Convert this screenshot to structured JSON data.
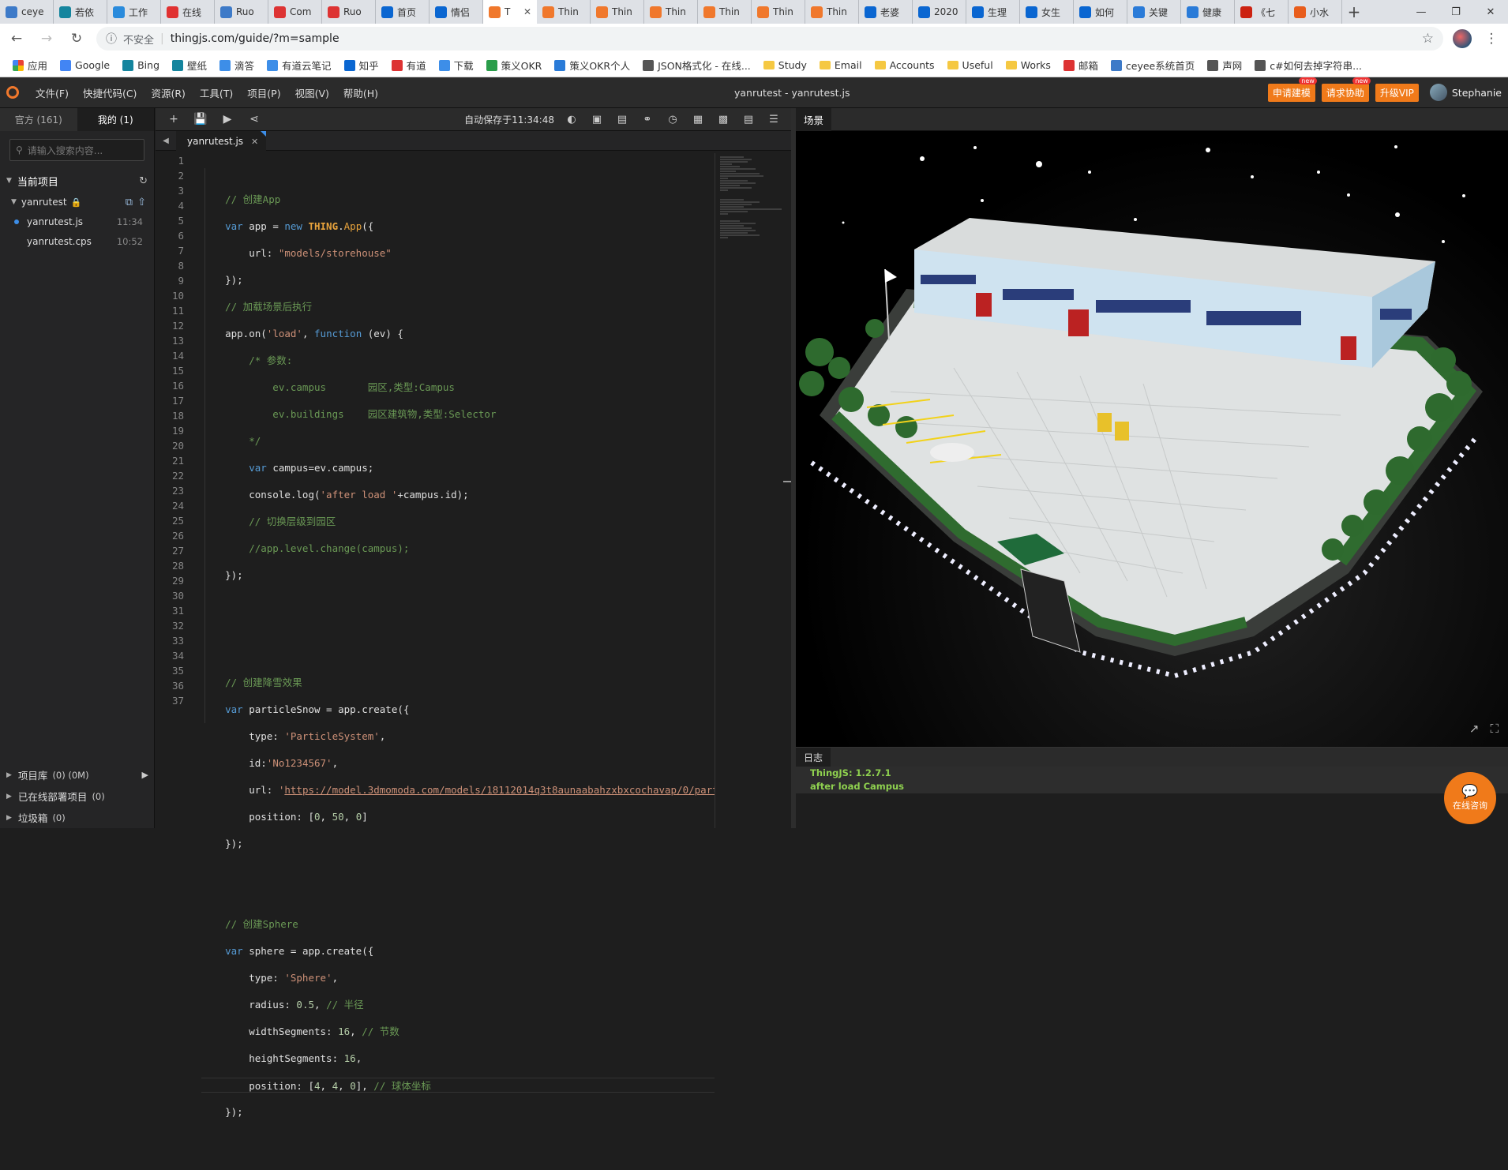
{
  "browser": {
    "tabs": [
      {
        "label": "ceye",
        "color": "#3d7ac8"
      },
      {
        "label": "若依",
        "color": "#15859e"
      },
      {
        "label": "工作",
        "color": "#2a8bdc"
      },
      {
        "label": "在线",
        "color": "#e03131"
      },
      {
        "label": "Ruo",
        "color": "#3d7ac8"
      },
      {
        "label": "Com",
        "color": "#d33"
      },
      {
        "label": "Ruo",
        "color": "#d33"
      },
      {
        "label": "首页",
        "color": "#0a66d1"
      },
      {
        "label": "情侣",
        "color": "#0a66d1"
      },
      {
        "label": "T",
        "color": "#f0782c",
        "active": true
      },
      {
        "label": "Thin",
        "color": "#f0782c"
      },
      {
        "label": "Thin",
        "color": "#f0782c"
      },
      {
        "label": "Thin",
        "color": "#f0782c"
      },
      {
        "label": "Thin",
        "color": "#f0782c"
      },
      {
        "label": "Thin",
        "color": "#f0782c"
      },
      {
        "label": "Thin",
        "color": "#f0782c"
      },
      {
        "label": "老婆",
        "color": "#0a66d1"
      },
      {
        "label": "2020",
        "color": "#0a66d1"
      },
      {
        "label": "生理",
        "color": "#0a66d1"
      },
      {
        "label": "女生",
        "color": "#0a66d1"
      },
      {
        "label": "如何",
        "color": "#0a66d1"
      },
      {
        "label": "关键",
        "color": "#2a7bd8"
      },
      {
        "label": "健康",
        "color": "#2a7bd8"
      },
      {
        "label": "《七",
        "color": "#c21"
      },
      {
        "label": "小水",
        "color": "#e85d1c"
      }
    ],
    "security_label": "不安全",
    "url": "thingjs.com/guide/?m=sample",
    "bookmarks": [
      {
        "label": "应用",
        "type": "apps"
      },
      {
        "label": "Google",
        "type": "icon",
        "color": "#4285f4"
      },
      {
        "label": "Bing",
        "type": "icon",
        "color": "#15859e"
      },
      {
        "label": "壁纸",
        "type": "icon",
        "color": "#15859e"
      },
      {
        "label": "滴答",
        "type": "icon",
        "color": "#3d8ee8"
      },
      {
        "label": "有道云笔记",
        "type": "icon",
        "color": "#3d8ee8"
      },
      {
        "label": "知乎",
        "type": "icon",
        "color": "#0a66d1"
      },
      {
        "label": "有道",
        "type": "icon",
        "color": "#d33"
      },
      {
        "label": "下载",
        "type": "icon",
        "color": "#3d8ee8"
      },
      {
        "label": "策义OKR",
        "type": "icon",
        "color": "#2a9d4a"
      },
      {
        "label": "策义OKR个人",
        "type": "icon",
        "color": "#2a7bd8"
      },
      {
        "label": "JSON格式化 - 在线...",
        "type": "icon",
        "color": "#555"
      },
      {
        "label": "Study",
        "type": "folder"
      },
      {
        "label": "Email",
        "type": "folder"
      },
      {
        "label": "Accounts",
        "type": "folder"
      },
      {
        "label": "Useful",
        "type": "folder"
      },
      {
        "label": "Works",
        "type": "folder"
      },
      {
        "label": "邮箱",
        "type": "icon",
        "color": "#d33"
      },
      {
        "label": "ceyee系统首页",
        "type": "icon",
        "color": "#3d7ac8"
      },
      {
        "label": "声网",
        "type": "icon",
        "color": "#555"
      },
      {
        "label": "c#如何去掉字符串...",
        "type": "icon",
        "color": "#555"
      }
    ]
  },
  "ide": {
    "menus": [
      "文件(F)",
      "快捷代码(C)",
      "资源(R)",
      "工具(T)",
      "项目(P)",
      "视图(V)",
      "帮助(H)"
    ],
    "title": "yanrutest - yanrutest.js",
    "apply_model": "申请建模",
    "request_help": "请求协助",
    "upgrade_vip": "升级VIP",
    "new_tag": "new",
    "username": "Stephanie",
    "accent_color": "#f07a1a"
  },
  "left": {
    "tab_official": "官方 (161)",
    "tab_mine": "我的 (1)",
    "search_placeholder": "请输入搜索内容...",
    "current_project": "当前项目",
    "project_name": "yanrutest",
    "files": [
      {
        "name": "yanrutest.js",
        "time": "11:34",
        "active": true
      },
      {
        "name": "yanrutest.cps",
        "time": "10:52",
        "active": false
      }
    ],
    "bottom": [
      {
        "label": "项目库",
        "count": "(0) (0M)"
      },
      {
        "label": "已在线部署项目",
        "count": "(0)"
      },
      {
        "label": "垃圾箱",
        "count": "(0)"
      }
    ]
  },
  "editor": {
    "autosave": "自动保存于11:34:48",
    "file_tab": "yanrutest.js"
  },
  "scene": {
    "tab": "场景",
    "log_tab": "日志",
    "log_lines": [
      "ThingJS: 1.2.7.1",
      "after load Campus"
    ],
    "chat_label": "在线咨询"
  }
}
